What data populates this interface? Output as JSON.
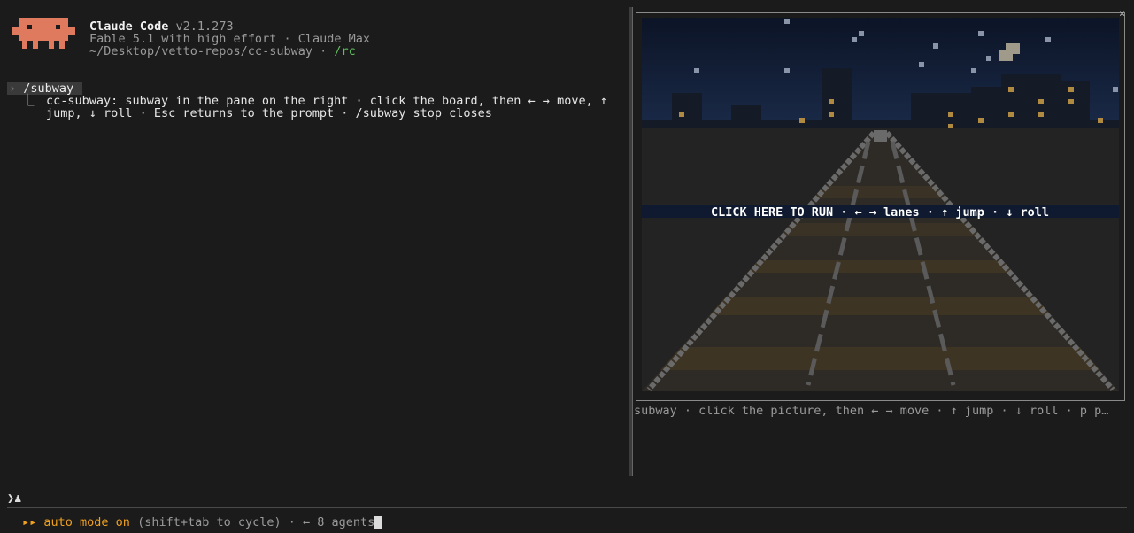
{
  "header": {
    "app_name": "Claude Code",
    "version": "v2.1.273",
    "model_line": "Fable 5.1 with high effort · Claude Max",
    "path_prefix": "~/Desktop/vetto-repos/cc-subway · ",
    "path_link": "/rc"
  },
  "transcript": {
    "command_glyph": "›",
    "command": "/subway",
    "result_prefix": "⎿",
    "result_line1": "cc-subway: subway in the pane on the right · click the board, then ← → move, ↑",
    "result_line2": "jump, ↓ roll · Esc returns to the prompt · /subway stop closes"
  },
  "game_pane": {
    "close_glyph": "×",
    "banner": "CLICK HERE TO RUN · ← → lanes · ↑ jump · ↓ roll",
    "caption": "subway · click the picture, then ← → move · ↑ jump · ↓ roll · p p…"
  },
  "input": {
    "prompt_glyph": "❯",
    "caret_glyph": "♟"
  },
  "status_bar": {
    "arrows": "▸▸ ",
    "mode": "auto mode on",
    "hint": " (shift+tab to cycle) · ← 8 agents"
  },
  "colors": {
    "background": "#1b1b1b",
    "logo": "#e07a5f",
    "accent_orange": "#f0a020",
    "link_green": "#5fbf5f",
    "sky": "#0f1a30"
  }
}
